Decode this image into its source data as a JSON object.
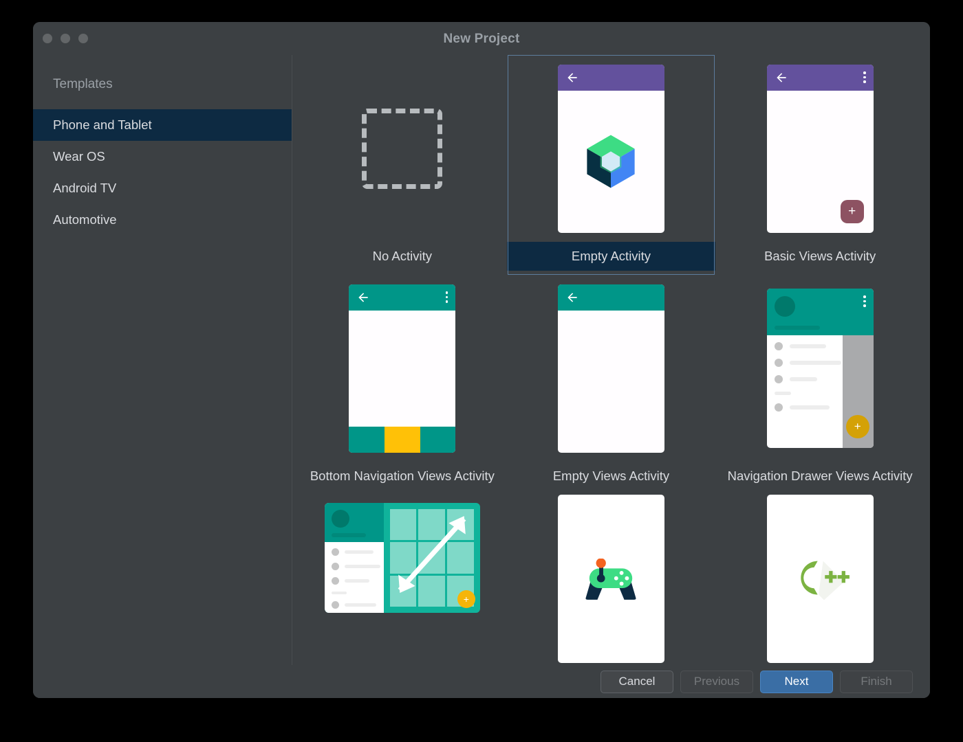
{
  "window": {
    "title": "New Project",
    "traffic_lights": [
      "close",
      "minimize",
      "zoom"
    ]
  },
  "sidebar": {
    "heading": "Templates",
    "items": [
      {
        "label": "Phone and Tablet",
        "selected": true
      },
      {
        "label": "Wear OS",
        "selected": false
      },
      {
        "label": "Android TV",
        "selected": false
      },
      {
        "label": "Automotive",
        "selected": false
      }
    ]
  },
  "templates": [
    {
      "label": "No Activity",
      "selected": false,
      "thumb": "dashed-square"
    },
    {
      "label": "Empty Activity",
      "selected": true,
      "thumb": "compose-cube-purple-appbar"
    },
    {
      "label": "Basic Views Activity",
      "selected": false,
      "thumb": "purple-appbar-fab"
    },
    {
      "label": "Bottom Navigation Views Activity",
      "selected": false,
      "thumb": "teal-appbar-bottom-nav"
    },
    {
      "label": "Empty Views Activity",
      "selected": false,
      "thumb": "teal-appbar-empty"
    },
    {
      "label": "Navigation Drawer Views Activity",
      "selected": false,
      "thumb": "nav-drawer"
    },
    {
      "label": "",
      "selected": false,
      "thumb": "responsive-landscape-grid"
    },
    {
      "label": "",
      "selected": false,
      "thumb": "game-controller"
    },
    {
      "label": "",
      "selected": false,
      "thumb": "cpp-logo"
    }
  ],
  "footer": {
    "buttons": [
      {
        "label": "Cancel",
        "state": "enabled"
      },
      {
        "label": "Previous",
        "state": "disabled"
      },
      {
        "label": "Next",
        "state": "primary"
      },
      {
        "label": "Finish",
        "state": "disabled"
      }
    ]
  },
  "colors": {
    "dialog_background": "#3c4043",
    "selection_navy": "#0d2a42",
    "selection_border": "#5d7d9e",
    "text_primary": "#dadce0",
    "text_muted": "#9aa0a6",
    "appbar_purple": "#63519d",
    "appbar_teal": "#009688",
    "fab_rose": "#8d5262",
    "fab_amber": "#d4a107",
    "bottom_nav_accent": "#ffc107",
    "primary_button_blue": "#3a6ea5",
    "compose_green": "#3ddc84",
    "compose_blue": "#4285f4",
    "compose_navy": "#073042",
    "cpp_green": "#7cb342",
    "controller_green": "#3ddc84",
    "controller_orange": "#f4621f"
  }
}
